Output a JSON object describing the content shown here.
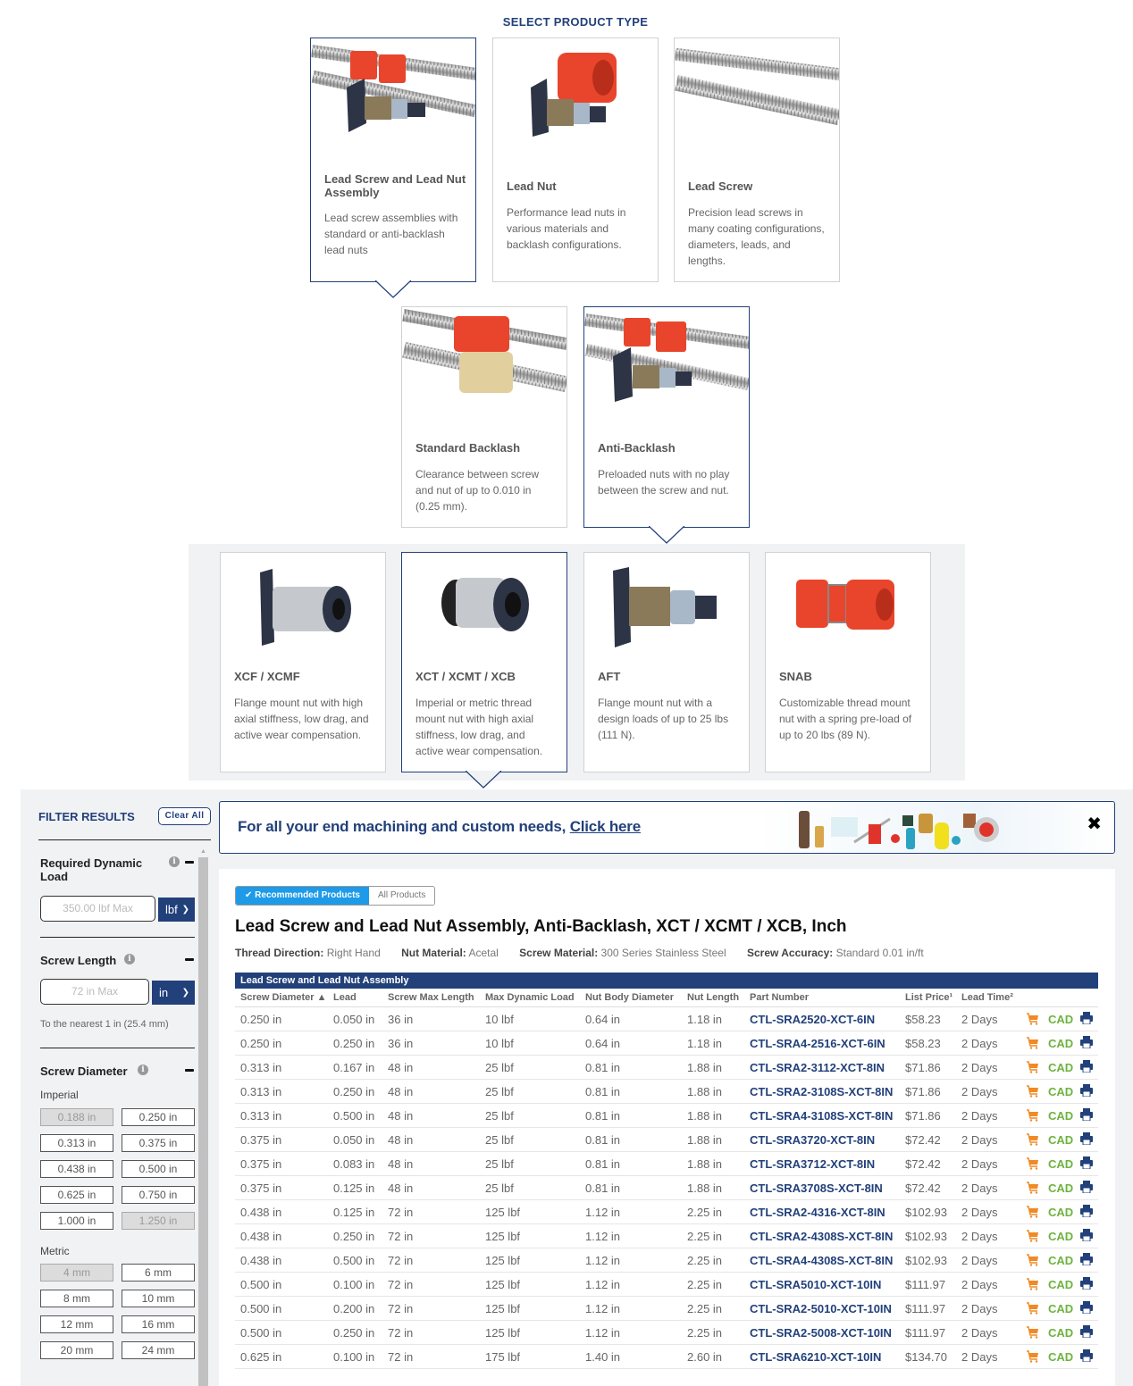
{
  "section_title": "SELECT PRODUCT TYPE",
  "product_types": [
    {
      "title": "Lead Screw and Lead Nut Assembly",
      "desc": "Lead screw assemblies with standard or anti-backlash lead nuts",
      "selected": true
    },
    {
      "title": "Lead Nut",
      "desc": "Performance lead nuts in various materials and backlash configurations.",
      "selected": false
    },
    {
      "title": "Lead Screw",
      "desc": "Precision lead screws in many coating configurations, diameters, leads, and lengths.",
      "selected": false
    }
  ],
  "backlash_types": [
    {
      "title": "Standard Backlash",
      "desc": "Clearance between screw and nut of up to 0.010 in (0.25 mm).",
      "selected": false
    },
    {
      "title": "Anti-Backlash",
      "desc": "Preloaded nuts with no play between the screw and nut.",
      "selected": true
    }
  ],
  "nut_types": [
    {
      "title": "XCF / XCMF",
      "desc": "Flange mount nut with high axial stiffness, low drag, and active wear compensation.",
      "selected": false
    },
    {
      "title": "XCT / XCMT / XCB",
      "desc": "Imperial or metric thread mount nut with high axial stiffness, low drag, and active wear compensation.",
      "selected": true
    },
    {
      "title": "AFT",
      "desc": "Flange mount nut with a design loads of up to 25 lbs (111 N).",
      "selected": false
    },
    {
      "title": "SNAB",
      "desc": "Customizable thread mount nut with a spring pre-load of up to 20 lbs (89 N).",
      "selected": false
    }
  ],
  "filters": {
    "title": "FILTER RESULTS",
    "clear_all": "Clear All",
    "dynamic_load": {
      "label": "Required Dynamic Load",
      "placeholder": "350.00 lbf Max",
      "unit": "lbf"
    },
    "screw_length": {
      "label": "Screw Length",
      "placeholder": "72 in Max",
      "unit": "in",
      "hint": "To the nearest 1 in (25.4 mm)"
    },
    "screw_diameter": {
      "label": "Screw Diameter",
      "imperial_label": "Imperial",
      "imperial": [
        {
          "label": "0.188 in",
          "disabled": true
        },
        {
          "label": "0.250 in",
          "disabled": false
        },
        {
          "label": "0.313 in",
          "disabled": false
        },
        {
          "label": "0.375 in",
          "disabled": false
        },
        {
          "label": "0.438 in",
          "disabled": false
        },
        {
          "label": "0.500 in",
          "disabled": false
        },
        {
          "label": "0.625 in",
          "disabled": false
        },
        {
          "label": "0.750 in",
          "disabled": false
        },
        {
          "label": "1.000 in",
          "disabled": false
        },
        {
          "label": "1.250 in",
          "disabled": true
        }
      ],
      "metric_label": "Metric",
      "metric": [
        {
          "label": "4 mm",
          "disabled": true
        },
        {
          "label": "6 mm",
          "disabled": false
        },
        {
          "label": "8 mm",
          "disabled": false
        },
        {
          "label": "10 mm",
          "disabled": false
        },
        {
          "label": "12 mm",
          "disabled": false
        },
        {
          "label": "16 mm",
          "disabled": false
        },
        {
          "label": "20 mm",
          "disabled": false
        },
        {
          "label": "24 mm",
          "disabled": false
        }
      ]
    }
  },
  "banner": {
    "text": "For all your end machining and custom needs, ",
    "link": "Click here",
    "close": "✖"
  },
  "results": {
    "toggle_recommended": "✔ Recommended Products",
    "toggle_all": "All Products",
    "title": "Lead Screw and Lead Nut Assembly, Anti-Backlash, XCT / XCMT / XCB, Inch",
    "specs": [
      {
        "label": "Thread Direction:",
        "value": "Right Hand"
      },
      {
        "label": "Nut Material:",
        "value": "Acetal"
      },
      {
        "label": "Screw Material:",
        "value": "300 Series Stainless Steel"
      },
      {
        "label": "Screw Accuracy:",
        "value": "Standard 0.01 in/ft"
      }
    ],
    "table_title": "Lead Screw and Lead Nut Assembly",
    "columns": [
      "Screw Diameter ▲",
      "Lead",
      "Screw Max Length",
      "Max Dynamic Load",
      "Nut Body Diameter",
      "Nut Length",
      "Part Number",
      "List Price¹",
      "Lead Time²"
    ],
    "cad_label": "CAD",
    "rows": [
      [
        "0.250 in",
        "0.050 in",
        "36 in",
        "10 lbf",
        "0.64 in",
        "1.18 in",
        "CTL-SRA2520-XCT-6IN",
        "$58.23",
        "2 Days"
      ],
      [
        "0.250 in",
        "0.250 in",
        "36 in",
        "10 lbf",
        "0.64 in",
        "1.18 in",
        "CTL-SRA4-2516-XCT-6IN",
        "$58.23",
        "2 Days"
      ],
      [
        "0.313 in",
        "0.167 in",
        "48 in",
        "25 lbf",
        "0.81 in",
        "1.88 in",
        "CTL-SRA2-3112-XCT-8IN",
        "$71.86",
        "2 Days"
      ],
      [
        "0.313 in",
        "0.250 in",
        "48 in",
        "25 lbf",
        "0.81 in",
        "1.88 in",
        "CTL-SRA2-3108S-XCT-8IN",
        "$71.86",
        "2 Days"
      ],
      [
        "0.313 in",
        "0.500 in",
        "48 in",
        "25 lbf",
        "0.81 in",
        "1.88 in",
        "CTL-SRA4-3108S-XCT-8IN",
        "$71.86",
        "2 Days"
      ],
      [
        "0.375 in",
        "0.050 in",
        "48 in",
        "25 lbf",
        "0.81 in",
        "1.88 in",
        "CTL-SRA3720-XCT-8IN",
        "$72.42",
        "2 Days"
      ],
      [
        "0.375 in",
        "0.083 in",
        "48 in",
        "25 lbf",
        "0.81 in",
        "1.88 in",
        "CTL-SRA3712-XCT-8IN",
        "$72.42",
        "2 Days"
      ],
      [
        "0.375 in",
        "0.125 in",
        "48 in",
        "25 lbf",
        "0.81 in",
        "1.88 in",
        "CTL-SRA3708S-XCT-8IN",
        "$72.42",
        "2 Days"
      ],
      [
        "0.438 in",
        "0.125 in",
        "72 in",
        "125 lbf",
        "1.12 in",
        "2.25 in",
        "CTL-SRA2-4316-XCT-8IN",
        "$102.93",
        "2 Days"
      ],
      [
        "0.438 in",
        "0.250 in",
        "72 in",
        "125 lbf",
        "1.12 in",
        "2.25 in",
        "CTL-SRA2-4308S-XCT-8IN",
        "$102.93",
        "2 Days"
      ],
      [
        "0.438 in",
        "0.500 in",
        "72 in",
        "125 lbf",
        "1.12 in",
        "2.25 in",
        "CTL-SRA4-4308S-XCT-8IN",
        "$102.93",
        "2 Days"
      ],
      [
        "0.500 in",
        "0.100 in",
        "72 in",
        "125 lbf",
        "1.12 in",
        "2.25 in",
        "CTL-SRA5010-XCT-10IN",
        "$111.97",
        "2 Days"
      ],
      [
        "0.500 in",
        "0.200 in",
        "72 in",
        "125 lbf",
        "1.12 in",
        "2.25 in",
        "CTL-SRA2-5010-XCT-10IN",
        "$111.97",
        "2 Days"
      ],
      [
        "0.500 in",
        "0.250 in",
        "72 in",
        "125 lbf",
        "1.12 in",
        "2.25 in",
        "CTL-SRA2-5008-XCT-10IN",
        "$111.97",
        "2 Days"
      ],
      [
        "0.625 in",
        "0.100 in",
        "72 in",
        "175 lbf",
        "1.40 in",
        "2.60 in",
        "CTL-SRA6210-XCT-10IN",
        "$134.70",
        "2 Days"
      ]
    ]
  },
  "colors": {
    "navy": "#22407a",
    "accent_blue": "#1e9be8",
    "cad_green": "#6db33f",
    "cart_orange": "#f08a24"
  }
}
